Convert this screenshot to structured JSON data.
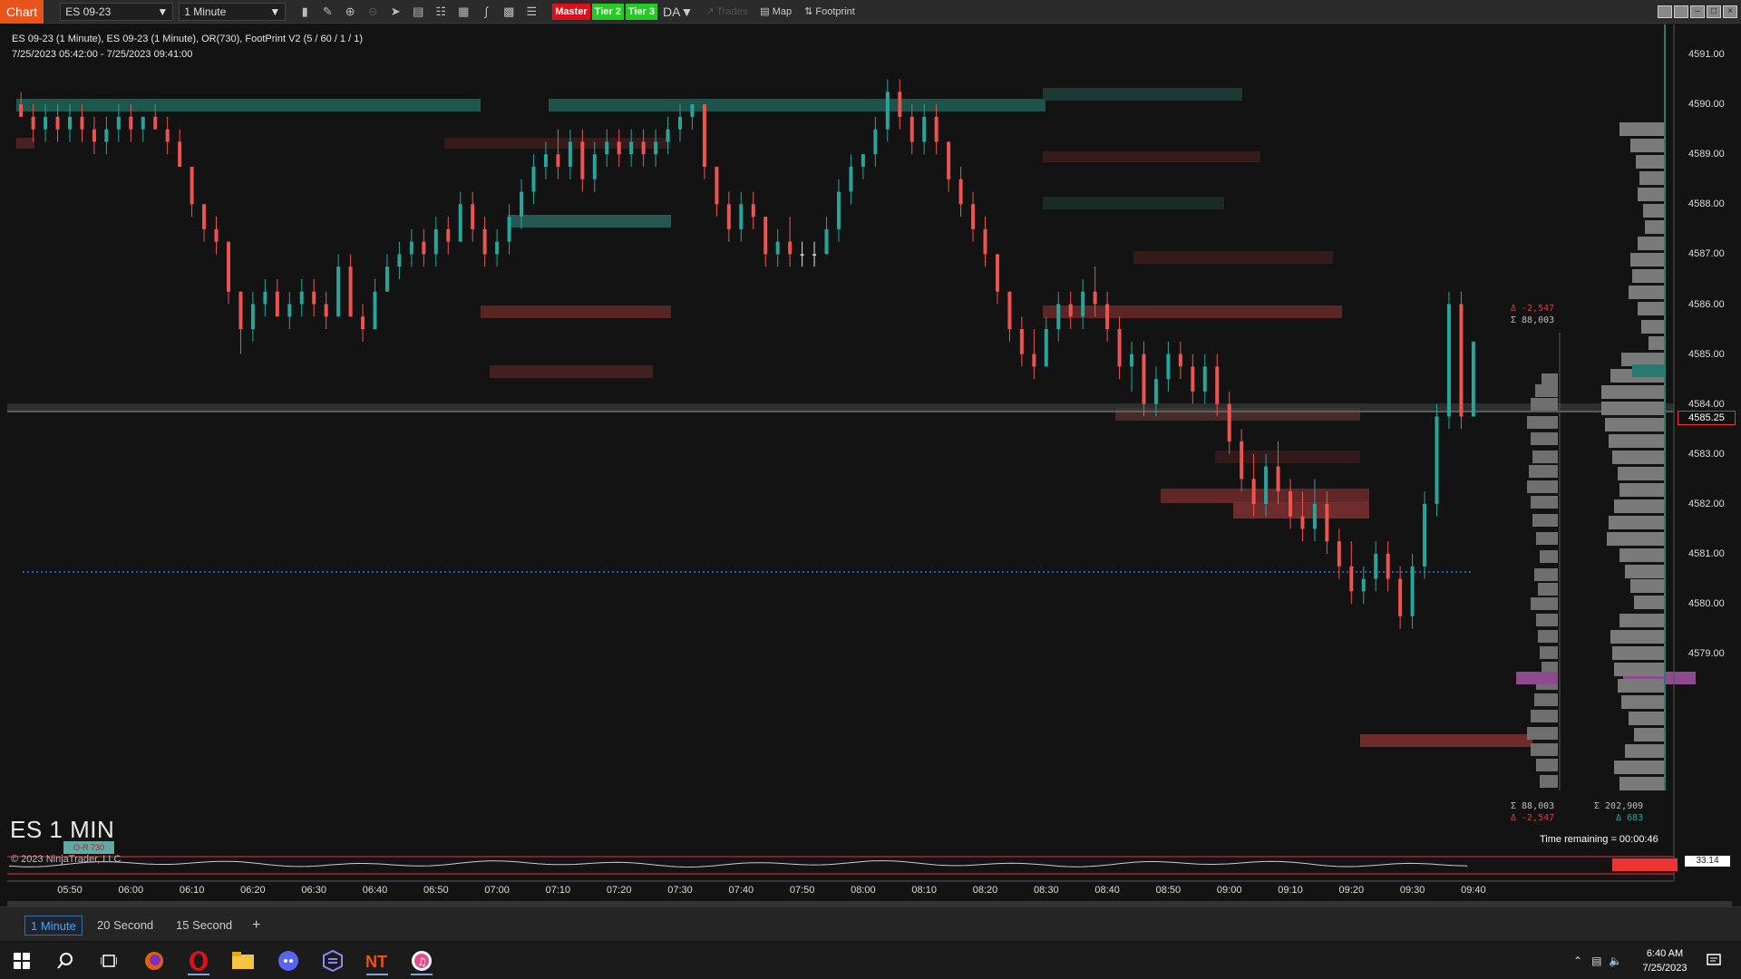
{
  "toolbar": {
    "chart_tag": "Chart",
    "instrument": "ES 09-23",
    "interval": "1 Minute",
    "badges": {
      "master": "Master",
      "tier2": "Tier 2",
      "tier3": "Tier 3"
    },
    "da_label": "DA▼",
    "trades_label": "Trades",
    "map_label": "Map",
    "footprint_label": "Footprint"
  },
  "chart": {
    "info_line1": "ES 09-23 (1 Minute), ES 09-23 (1 Minute), OR(730), FootPrint V2 (5 / 60 / 1 / 1)",
    "info_line2": "7/25/2023 05:42:00 - 7/25/2023 09:41:00",
    "big_label": "ES 1 MIN",
    "copyright": "© 2023 NinjaTrader, LLC",
    "or_tag": "O-R 730",
    "time_remaining": "Time remaining = 00:00:46",
    "current_price": "4585.25",
    "osc_value": "33.14",
    "price_ticks": [
      "4591.00",
      "4590.00",
      "4589.00",
      "4588.00",
      "4587.00",
      "4586.00",
      "4585.00",
      "4584.00",
      "4583.00",
      "4582.00",
      "4581.00",
      "4580.00",
      "4579.00"
    ],
    "time_ticks": [
      "05:50",
      "06:00",
      "06:10",
      "06:20",
      "06:30",
      "06:40",
      "06:50",
      "07:00",
      "07:10",
      "07:20",
      "07:30",
      "07:40",
      "07:50",
      "08:00",
      "08:10",
      "08:20",
      "08:30",
      "08:40",
      "08:50",
      "09:00",
      "09:10",
      "09:20",
      "09:30",
      "09:40"
    ],
    "vp_top_delta": "Δ -2,547",
    "vp_top_sum": "Σ 88,003",
    "vp_bottom_sum": "Σ 88,003",
    "vp_bottom_delta": "Δ -2,547",
    "vp2_sum": "Σ 202,909",
    "vp2_delta": "Δ 683",
    "colors": {
      "up": "#26a69a",
      "down": "#ef5350",
      "doji": "#e0e0e0",
      "accent": "#e8541a",
      "poc": "#8e4a8e"
    }
  },
  "tabs": [
    "1 Minute",
    "20 Second",
    "15 Second",
    "+"
  ],
  "taskbar": {
    "time": "6:40 AM",
    "date": "7/25/2023"
  },
  "chart_data": {
    "type": "candlestick",
    "title": "ES 09-23 (1 Minute)",
    "ylim": [
      4578.6,
      4591.2
    ],
    "x_range": [
      "05:42",
      "09:41"
    ],
    "series": [
      {
        "ohlc": [
          [
            "05:42",
            4590.0,
            4590.25,
            4589.75,
            4589.75
          ],
          [
            "05:44",
            4589.75,
            4590.0,
            4589.25,
            4589.5
          ],
          [
            "05:46",
            4589.5,
            4590.0,
            4589.25,
            4589.75
          ],
          [
            "05:48",
            4589.75,
            4590.0,
            4589.25,
            4589.5
          ],
          [
            "05:50",
            4589.5,
            4590.0,
            4589.25,
            4589.75
          ],
          [
            "05:52",
            4589.75,
            4590.0,
            4589.25,
            4589.5
          ],
          [
            "05:54",
            4589.5,
            4589.75,
            4589.0,
            4589.25
          ],
          [
            "05:56",
            4589.25,
            4589.75,
            4589.0,
            4589.5
          ],
          [
            "05:58",
            4589.5,
            4590.0,
            4589.25,
            4589.75
          ],
          [
            "06:00",
            4589.75,
            4590.0,
            4589.25,
            4589.5
          ],
          [
            "06:02",
            4589.5,
            4589.75,
            4589.25,
            4589.75
          ],
          [
            "06:04",
            4589.75,
            4590.0,
            4589.5,
            4589.5
          ],
          [
            "06:06",
            4589.5,
            4589.75,
            4589.0,
            4589.25
          ],
          [
            "06:08",
            4589.25,
            4589.5,
            4588.75,
            4588.75
          ],
          [
            "06:10",
            4588.75,
            4588.75,
            4587.75,
            4588.0
          ],
          [
            "06:12",
            4588.0,
            4588.0,
            4587.25,
            4587.5
          ],
          [
            "06:14",
            4587.5,
            4587.75,
            4587.0,
            4587.25
          ],
          [
            "06:16",
            4587.25,
            4587.25,
            4586.0,
            4586.25
          ],
          [
            "06:18",
            4586.25,
            4586.25,
            4585.0,
            4585.5
          ],
          [
            "06:20",
            4585.5,
            4586.25,
            4585.25,
            4586.0
          ],
          [
            "06:22",
            4586.0,
            4586.5,
            4585.75,
            4586.25
          ],
          [
            "06:24",
            4586.25,
            4586.5,
            4585.75,
            4585.75
          ],
          [
            "06:26",
            4585.75,
            4586.25,
            4585.5,
            4586.0
          ],
          [
            "06:28",
            4586.0,
            4586.5,
            4585.75,
            4586.25
          ],
          [
            "06:30",
            4586.25,
            4586.5,
            4585.75,
            4586.0
          ],
          [
            "06:32",
            4586.0,
            4586.25,
            4585.5,
            4585.75
          ],
          [
            "06:34",
            4585.75,
            4587.0,
            4585.75,
            4586.75
          ],
          [
            "06:36",
            4586.75,
            4587.0,
            4585.75,
            4585.75
          ],
          [
            "06:38",
            4585.75,
            4586.0,
            4585.25,
            4585.5
          ],
          [
            "06:40",
            4585.5,
            4586.5,
            4585.5,
            4586.25
          ],
          [
            "06:42",
            4586.25,
            4587.0,
            4586.25,
            4586.75
          ],
          [
            "06:44",
            4586.75,
            4587.25,
            4586.5,
            4587.0
          ],
          [
            "06:46",
            4587.0,
            4587.5,
            4586.75,
            4587.25
          ],
          [
            "06:48",
            4587.25,
            4587.5,
            4586.75,
            4587.0
          ],
          [
            "06:50",
            4587.0,
            4587.75,
            4586.75,
            4587.5
          ],
          [
            "06:52",
            4587.5,
            4587.75,
            4587.0,
            4587.25
          ],
          [
            "06:54",
            4587.25,
            4588.25,
            4587.25,
            4588.0
          ],
          [
            "06:56",
            4588.0,
            4588.25,
            4587.25,
            4587.5
          ],
          [
            "06:58",
            4587.5,
            4587.75,
            4586.75,
            4587.0
          ],
          [
            "07:00",
            4587.0,
            4587.5,
            4586.75,
            4587.25
          ],
          [
            "07:02",
            4587.25,
            4588.0,
            4587.0,
            4587.75
          ],
          [
            "07:04",
            4587.75,
            4588.5,
            4587.5,
            4588.25
          ],
          [
            "07:06",
            4588.25,
            4589.0,
            4588.0,
            4588.75
          ],
          [
            "07:08",
            4588.75,
            4589.25,
            4588.5,
            4589.0
          ],
          [
            "07:10",
            4589.0,
            4589.5,
            4588.5,
            4588.75
          ],
          [
            "07:12",
            4588.75,
            4589.5,
            4588.5,
            4589.25
          ],
          [
            "07:14",
            4589.25,
            4589.5,
            4588.25,
            4588.5
          ],
          [
            "07:16",
            4588.5,
            4589.25,
            4588.25,
            4589.0
          ],
          [
            "07:18",
            4589.0,
            4589.5,
            4588.75,
            4589.25
          ],
          [
            "07:20",
            4589.25,
            4589.5,
            4588.75,
            4589.0
          ],
          [
            "07:22",
            4589.0,
            4589.5,
            4588.75,
            4589.25
          ],
          [
            "07:24",
            4589.25,
            4589.5,
            4588.75,
            4589.0
          ],
          [
            "07:26",
            4589.0,
            4589.5,
            4588.75,
            4589.25
          ],
          [
            "07:28",
            4589.25,
            4589.75,
            4589.0,
            4589.5
          ],
          [
            "07:30",
            4589.5,
            4590.0,
            4589.25,
            4589.75
          ],
          [
            "07:32",
            4589.75,
            4590.0,
            4589.5,
            4590.0
          ],
          [
            "07:34",
            4590.0,
            4590.0,
            4588.5,
            4588.75
          ],
          [
            "07:36",
            4588.75,
            4588.75,
            4587.75,
            4588.0
          ],
          [
            "07:38",
            4588.0,
            4588.25,
            4587.25,
            4587.5
          ],
          [
            "07:40",
            4587.5,
            4588.25,
            4587.25,
            4588.0
          ],
          [
            "07:42",
            4588.0,
            4588.25,
            4587.5,
            4587.75
          ],
          [
            "07:44",
            4587.75,
            4587.75,
            4586.75,
            4587.0
          ],
          [
            "07:46",
            4587.0,
            4587.5,
            4586.75,
            4587.25
          ],
          [
            "07:48",
            4587.25,
            4587.75,
            4586.75,
            4587.0
          ],
          [
            "07:50",
            4587.0,
            4587.25,
            4586.75,
            4587.0
          ],
          [
            "07:52",
            4587.0,
            4587.25,
            4586.75,
            4587.0
          ],
          [
            "07:54",
            4587.0,
            4587.75,
            4587.0,
            4587.5
          ],
          [
            "07:56",
            4587.5,
            4588.5,
            4587.25,
            4588.25
          ],
          [
            "07:58",
            4588.25,
            4589.0,
            4588.0,
            4588.75
          ],
          [
            "08:00",
            4588.75,
            4589.0,
            4588.5,
            4589.0
          ],
          [
            "08:02",
            4589.0,
            4589.75,
            4588.75,
            4589.5
          ],
          [
            "08:04",
            4589.5,
            4590.5,
            4589.25,
            4590.25
          ],
          [
            "08:06",
            4590.25,
            4590.5,
            4589.5,
            4589.75
          ],
          [
            "08:08",
            4589.75,
            4590.0,
            4589.0,
            4589.25
          ],
          [
            "08:10",
            4589.25,
            4590.0,
            4589.0,
            4589.75
          ],
          [
            "08:12",
            4589.75,
            4590.0,
            4589.0,
            4589.25
          ],
          [
            "08:14",
            4589.25,
            4589.25,
            4588.25,
            4588.5
          ],
          [
            "08:16",
            4588.5,
            4588.75,
            4587.75,
            4588.0
          ],
          [
            "08:18",
            4588.0,
            4588.25,
            4587.25,
            4587.5
          ],
          [
            "08:20",
            4587.5,
            4587.75,
            4586.75,
            4587.0
          ],
          [
            "08:22",
            4587.0,
            4587.0,
            4586.0,
            4586.25
          ],
          [
            "08:24",
            4586.25,
            4586.25,
            4585.25,
            4585.5
          ],
          [
            "08:26",
            4585.5,
            4585.75,
            4584.75,
            4585.0
          ],
          [
            "08:28",
            4585.0,
            4585.5,
            4584.5,
            4584.75
          ],
          [
            "08:30",
            4584.75,
            4585.75,
            4584.75,
            4585.5
          ],
          [
            "08:32",
            4585.5,
            4586.25,
            4585.25,
            4586.0
          ],
          [
            "08:34",
            4586.0,
            4586.25,
            4585.5,
            4585.75
          ],
          [
            "08:36",
            4585.75,
            4586.5,
            4585.5,
            4586.25
          ],
          [
            "08:38",
            4586.25,
            4586.75,
            4585.75,
            4586.0
          ],
          [
            "08:40",
            4586.0,
            4586.25,
            4585.25,
            4585.5
          ],
          [
            "08:42",
            4585.5,
            4585.75,
            4584.5,
            4584.75
          ],
          [
            "08:44",
            4584.75,
            4585.25,
            4584.25,
            4585.0
          ],
          [
            "08:46",
            4585.0,
            4585.25,
            4583.75,
            4584.0
          ],
          [
            "08:48",
            4584.0,
            4584.75,
            4583.75,
            4584.5
          ],
          [
            "08:50",
            4584.5,
            4585.25,
            4584.25,
            4585.0
          ],
          [
            "08:52",
            4585.0,
            4585.25,
            4584.5,
            4584.75
          ],
          [
            "08:54",
            4584.75,
            4585.0,
            4584.0,
            4584.25
          ],
          [
            "08:56",
            4584.25,
            4585.0,
            4584.0,
            4584.75
          ],
          [
            "08:58",
            4584.75,
            4585.0,
            4583.75,
            4584.0
          ],
          [
            "09:00",
            4584.0,
            4584.25,
            4583.0,
            4583.25
          ],
          [
            "09:02",
            4583.25,
            4583.5,
            4582.25,
            4582.5
          ],
          [
            "09:04",
            4582.5,
            4583.0,
            4581.75,
            4582.0
          ],
          [
            "09:06",
            4582.0,
            4583.0,
            4581.75,
            4582.75
          ],
          [
            "09:08",
            4582.75,
            4583.25,
            4582.0,
            4582.25
          ],
          [
            "09:10",
            4582.25,
            4582.5,
            4581.5,
            4581.75
          ],
          [
            "09:12",
            4581.75,
            4582.25,
            4581.25,
            4581.5
          ],
          [
            "09:14",
            4581.5,
            4582.5,
            4581.25,
            4582.0
          ],
          [
            "09:16",
            4582.0,
            4582.25,
            4581.0,
            4581.25
          ],
          [
            "09:18",
            4581.25,
            4581.5,
            4580.5,
            4580.75
          ],
          [
            "09:20",
            4580.75,
            4581.25,
            4580.0,
            4580.25
          ],
          [
            "09:22",
            4580.25,
            4580.75,
            4580.0,
            4580.5
          ],
          [
            "09:24",
            4580.5,
            4581.25,
            4580.25,
            4581.0
          ],
          [
            "09:26",
            4581.0,
            4581.25,
            4580.25,
            4580.5
          ],
          [
            "09:28",
            4580.5,
            4580.75,
            4579.5,
            4579.75
          ],
          [
            "09:30",
            4579.75,
            4581.0,
            4579.5,
            4580.75
          ],
          [
            "09:32",
            4580.75,
            4582.25,
            4580.5,
            4582.0
          ],
          [
            "09:34",
            4582.0,
            4584.0,
            4581.75,
            4583.75
          ],
          [
            "09:36",
            4583.75,
            4586.25,
            4583.5,
            4586.0
          ],
          [
            "09:38",
            4586.0,
            4586.25,
            4583.5,
            4583.75
          ],
          [
            "09:40",
            4583.75,
            4585.25,
            4583.75,
            4585.25
          ]
        ]
      }
    ]
  }
}
